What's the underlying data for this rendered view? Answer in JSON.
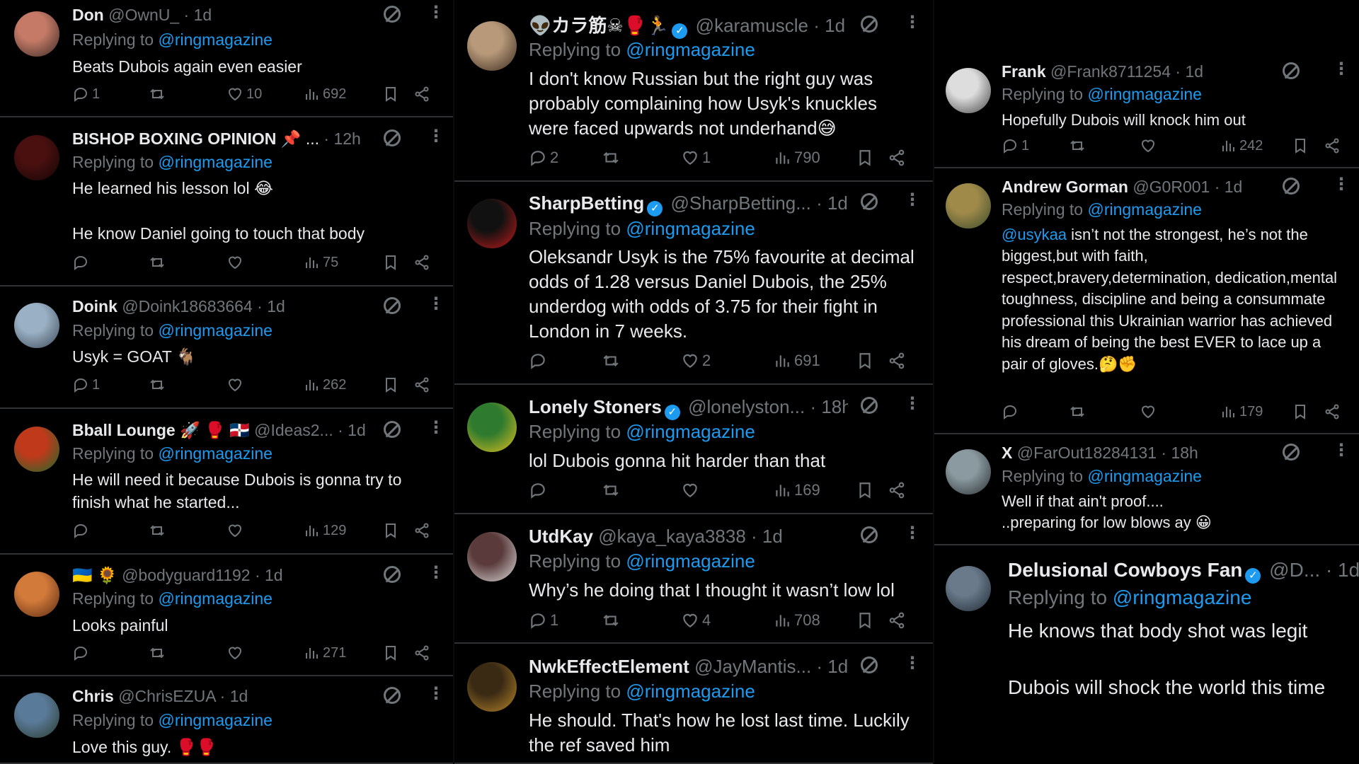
{
  "common": {
    "replying_to": "Replying to",
    "reply_handle": "@ringmagazine"
  },
  "col1": [
    {
      "name": "Don",
      "handle": "@OwnU_",
      "time": "· 1d",
      "text": "Beats Dubois again even easier",
      "replies": "1",
      "likes": "10",
      "views": "692"
    },
    {
      "name": "BISHOP BOXING OPINION",
      "name_suffix": "📌 ...",
      "handle": "",
      "time": "· 12h",
      "text": "He learned his lesson lol 😂\n\nHe know Daniel going to touch that body",
      "replies": "",
      "likes": "",
      "views": "75"
    },
    {
      "name": "Doink",
      "handle": "@Doink18683664",
      "time": "· 1d",
      "text": "Usyk = GOAT 🐐",
      "replies": "1",
      "likes": "",
      "views": "262"
    },
    {
      "name": "Bball Lounge",
      "name_suffix": "🚀 🥊 🇩🇴",
      "handle": "@Ideas2...",
      "time": "· 1d",
      "text": "He will need it because Dubois is gonna try to finish what he started...",
      "replies": "",
      "likes": "",
      "views": "129"
    },
    {
      "name": "🇺🇦 🌻",
      "handle": "@bodyguard1192",
      "time": "· 1d",
      "text": "Looks painful",
      "replies": "",
      "likes": "",
      "views": "271"
    },
    {
      "name": "Chris",
      "handle": "@ChrisEZUA",
      "time": "· 1d",
      "text": "Love this guy. 🥊🥊"
    }
  ],
  "col2": [
    {
      "name": "👽カラ筋☠🥊🏃",
      "handle": "@karamuscle",
      "time": "· 1d",
      "verified": true,
      "text": "I don't know Russian but the right guy was probably complaining how Usyk's knuckles were faced upwards not underhand😅",
      "replies": "2",
      "likes": "1",
      "views": "790"
    },
    {
      "name": "SharpBetting",
      "handle": "@SharpBetting...",
      "time": "· 1d",
      "verified": true,
      "text": "Oleksandr Usyk is the 75% favourite at decimal odds of 1.28 versus Daniel Dubois, the 25% underdog with odds of 3.75 for their fight in London in 7 weeks.",
      "replies": "",
      "likes": "2",
      "views": "691"
    },
    {
      "name": "Lonely Stoners",
      "handle": "@lonelyston...",
      "time": "· 18h",
      "verified": true,
      "text": "lol Dubois gonna hit harder than that",
      "replies": "",
      "likes": "",
      "views": "169"
    },
    {
      "name": "UtdKay",
      "handle": "@kaya_kaya3838",
      "time": "· 1d",
      "text": "Why’s he doing that I thought it wasn’t low lol",
      "replies": "1",
      "likes": "4",
      "views": "708"
    },
    {
      "name": "NwkEffectElement",
      "handle": "@JayMantis...",
      "time": "· 1d",
      "text": "He should. That's how he lost last time. Luckily the ref saved him"
    }
  ],
  "col3": [
    {
      "name": "Frank",
      "handle": "@Frank8711254",
      "time": "· 1d",
      "text": "Hopefully Dubois will knock him out",
      "replies": "1",
      "likes": "",
      "views": "242"
    },
    {
      "name": "Andrew Gorman",
      "handle": "@G0R001",
      "time": "· 1d",
      "mention": "@usykaa",
      "text": " isn’t not the strongest, he’s not the biggest,but with faith, respect,bravery,determination, dedication,mental toughness, discipline and being a consummate professional this Ukrainian warrior has achieved his dream of being the best EVER to lace up a pair of gloves.🤔✊",
      "replies": "",
      "likes": "",
      "views": "179"
    },
    {
      "name": "X",
      "handle": "@FarOut18284131",
      "time": "· 18h",
      "text": "Well if that ain't proof....\n..preparing for low blows ay  😀"
    },
    {
      "name": "Delusional Cowboys Fan",
      "handle": "@D...",
      "time": "· 1d",
      "verified": true,
      "text": "He knows that body shot was legit\n\nDubois will shock the world this time"
    }
  ],
  "colors": {
    "background": "#000000",
    "text": "#e7e9ea",
    "muted": "#71767b",
    "link": "#1d9bf0",
    "divider": "#2f3336"
  },
  "icons": [
    "reply-icon",
    "retweet-icon",
    "like-icon",
    "views-icon",
    "bookmark-icon",
    "share-icon",
    "grok-icon",
    "more-icon",
    "verified-badge-icon"
  ]
}
